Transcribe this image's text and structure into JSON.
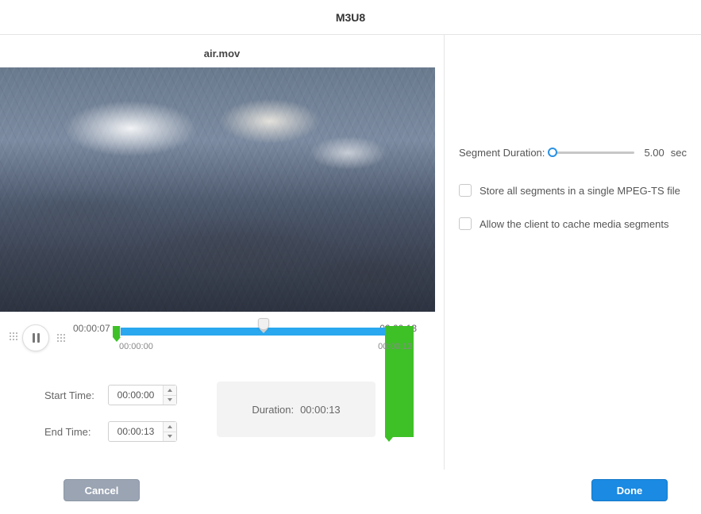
{
  "header": {
    "title": "M3U8"
  },
  "file": {
    "name": "air.mov"
  },
  "timeline": {
    "pos_left": "00:00:07",
    "pos_right": "00:00:13",
    "range_start": "00:00:00",
    "range_end": "00:00:13"
  },
  "fields": {
    "start_label": "Start Time:",
    "start_value": "00:00:00",
    "end_label": "End Time:",
    "end_value": "00:00:13",
    "duration_label": "Duration:",
    "duration_value": "00:00:13"
  },
  "settings": {
    "segment_label": "Segment Duration:",
    "segment_value": "5.00",
    "segment_unit": "sec",
    "single_file_label": "Store all segments in a single MPEG-TS file",
    "single_file_checked": false,
    "cache_label": "Allow the client to cache media segments",
    "cache_checked": false
  },
  "footer": {
    "cancel": "Cancel",
    "done": "Done"
  }
}
